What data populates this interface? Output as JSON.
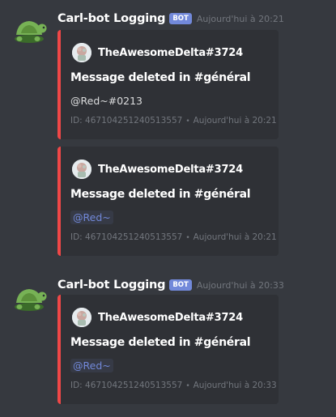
{
  "messages": [
    {
      "author": "Carl-bot Logging",
      "tag": "BOT",
      "timestamp": "Aujourd'hui à 20:21",
      "embeds": [
        {
          "author_name": "TheAwesomeDelta#3724",
          "title": "Message deleted in #général",
          "description": "@Red~#0213",
          "footer_id": "ID: 467104251240513557",
          "footer_sep": "•",
          "footer_time": "Aujourd'hui à 20:21"
        },
        {
          "author_name": "TheAwesomeDelta#3724",
          "title": "Message deleted in #général",
          "description": "@Red~",
          "footer_id": "ID: 467104251240513557",
          "footer_sep": "•",
          "footer_time": "Aujourd'hui à 20:21"
        }
      ]
    },
    {
      "author": "Carl-bot Logging",
      "tag": "BOT",
      "timestamp": "Aujourd'hui à 20:33",
      "embeds": [
        {
          "author_name": "TheAwesomeDelta#3724",
          "title": "Message deleted in #général",
          "description": "@Red~",
          "footer_id": "ID: 467104251240513557",
          "footer_sep": "•",
          "footer_time": "Aujourd'hui à 20:33"
        }
      ]
    }
  ],
  "colors": {
    "background": "#36393f",
    "embed_bg": "#2f3136",
    "embed_border": "#f04747",
    "bot_tag": "#7289da",
    "mention": "#7289da"
  },
  "icons": {
    "bot_avatar": "turtle-icon",
    "embed_author_avatar": "user-avatar-icon"
  }
}
